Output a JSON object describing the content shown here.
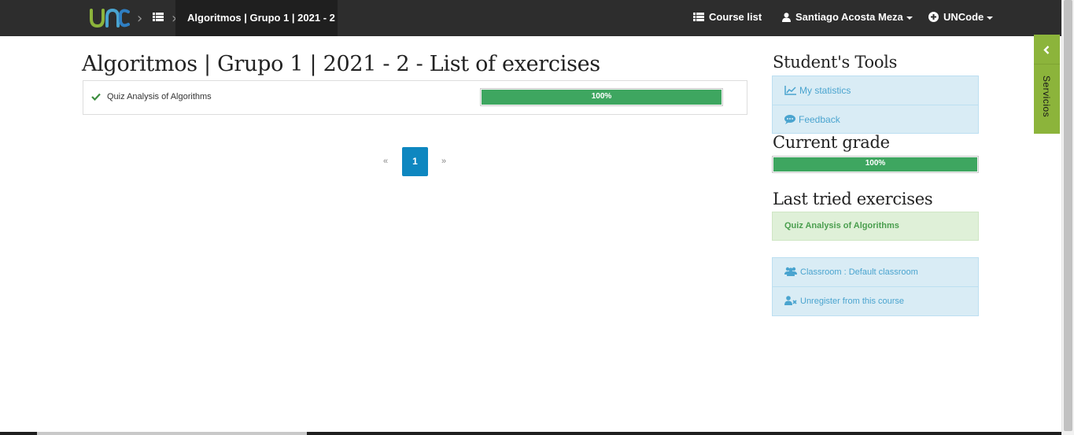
{
  "navbar": {
    "logo_text": "UNC",
    "active_course": "Algoritmos | Grupo 1 | 2021 - 2",
    "course_list_label": "Course list",
    "user_name": "Santiago Acosta Meza",
    "app_menu_label": "UNCode"
  },
  "main": {
    "title": "Algoritmos | Grupo 1 | 2021 - 2 - List of exercises",
    "exercises": [
      {
        "name": "Quiz Analysis of Algorithms",
        "progress_label": "100%",
        "progress": 1.0,
        "status_icon": "check-icon"
      }
    ],
    "pagination": {
      "prev": "«",
      "current": "1",
      "next": "»"
    }
  },
  "sidebar": {
    "tools_heading": "Student's Tools",
    "tools": [
      {
        "label": "My statistics",
        "icon": "line-chart-icon"
      },
      {
        "label": "Feedback",
        "icon": "comment-icon"
      }
    ],
    "grade_heading": "Current grade",
    "grade_label": "100%",
    "grade": 1.0,
    "last_heading": "Last tried exercises",
    "last_exercise": "Quiz Analysis of Algorithms",
    "classroom": [
      {
        "label": "Classroom : Default classroom",
        "icon": "users-icon"
      },
      {
        "label": "Unregister from this course",
        "icon": "user-remove-icon"
      }
    ]
  },
  "servicios": {
    "label": "Servicios"
  },
  "colors": {
    "navbar": "#2d2d2d",
    "progress": "#3ea660",
    "info_bg": "#d9ecf5",
    "info_text": "#4aa4cf",
    "success_bg": "#dff0d8",
    "pagination_active": "#0e87c0",
    "servicios": "#8cb43b"
  }
}
